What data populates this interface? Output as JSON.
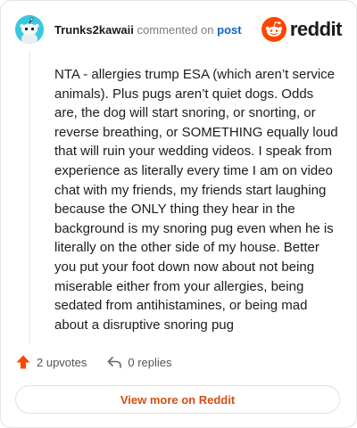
{
  "comment": {
    "username": "Trunks2kawaii",
    "action_text": "commented on",
    "post_link": "post",
    "body": "NTA - allergies trump ESA (which aren’t service animals). Plus pugs aren’t quiet dogs. Odds are, the dog will start snoring, or snorting, or reverse breathing, or SOMETHING equally loud that will ruin your wedding videos. I speak from experience as literally every time I am on video chat with my friends, my friends start laughing because the ONLY thing they hear in the background is my snoring pug even when he is literally on the other side of my house. Better you put your foot down now about not being miserable either from your allergies, being sedated from antihistamines, or being mad about a disruptive snoring pug"
  },
  "brand": {
    "logo_text": "reddit",
    "accent": "#ff4500"
  },
  "footer": {
    "upvotes_label": "2 upvotes",
    "replies_label": "0 replies",
    "view_more_label": "View more on Reddit"
  },
  "icons": {
    "avatar": "snoo-avatar-icon",
    "logo": "reddit-logo-icon",
    "upvote": "upvote-arrow-icon",
    "reply": "reply-arrow-icon"
  },
  "colors": {
    "avatar_bg": "#3ac8e0",
    "upvote": "#ff4500",
    "link": "#0a64c8",
    "view_more_text": "#d44d13"
  }
}
